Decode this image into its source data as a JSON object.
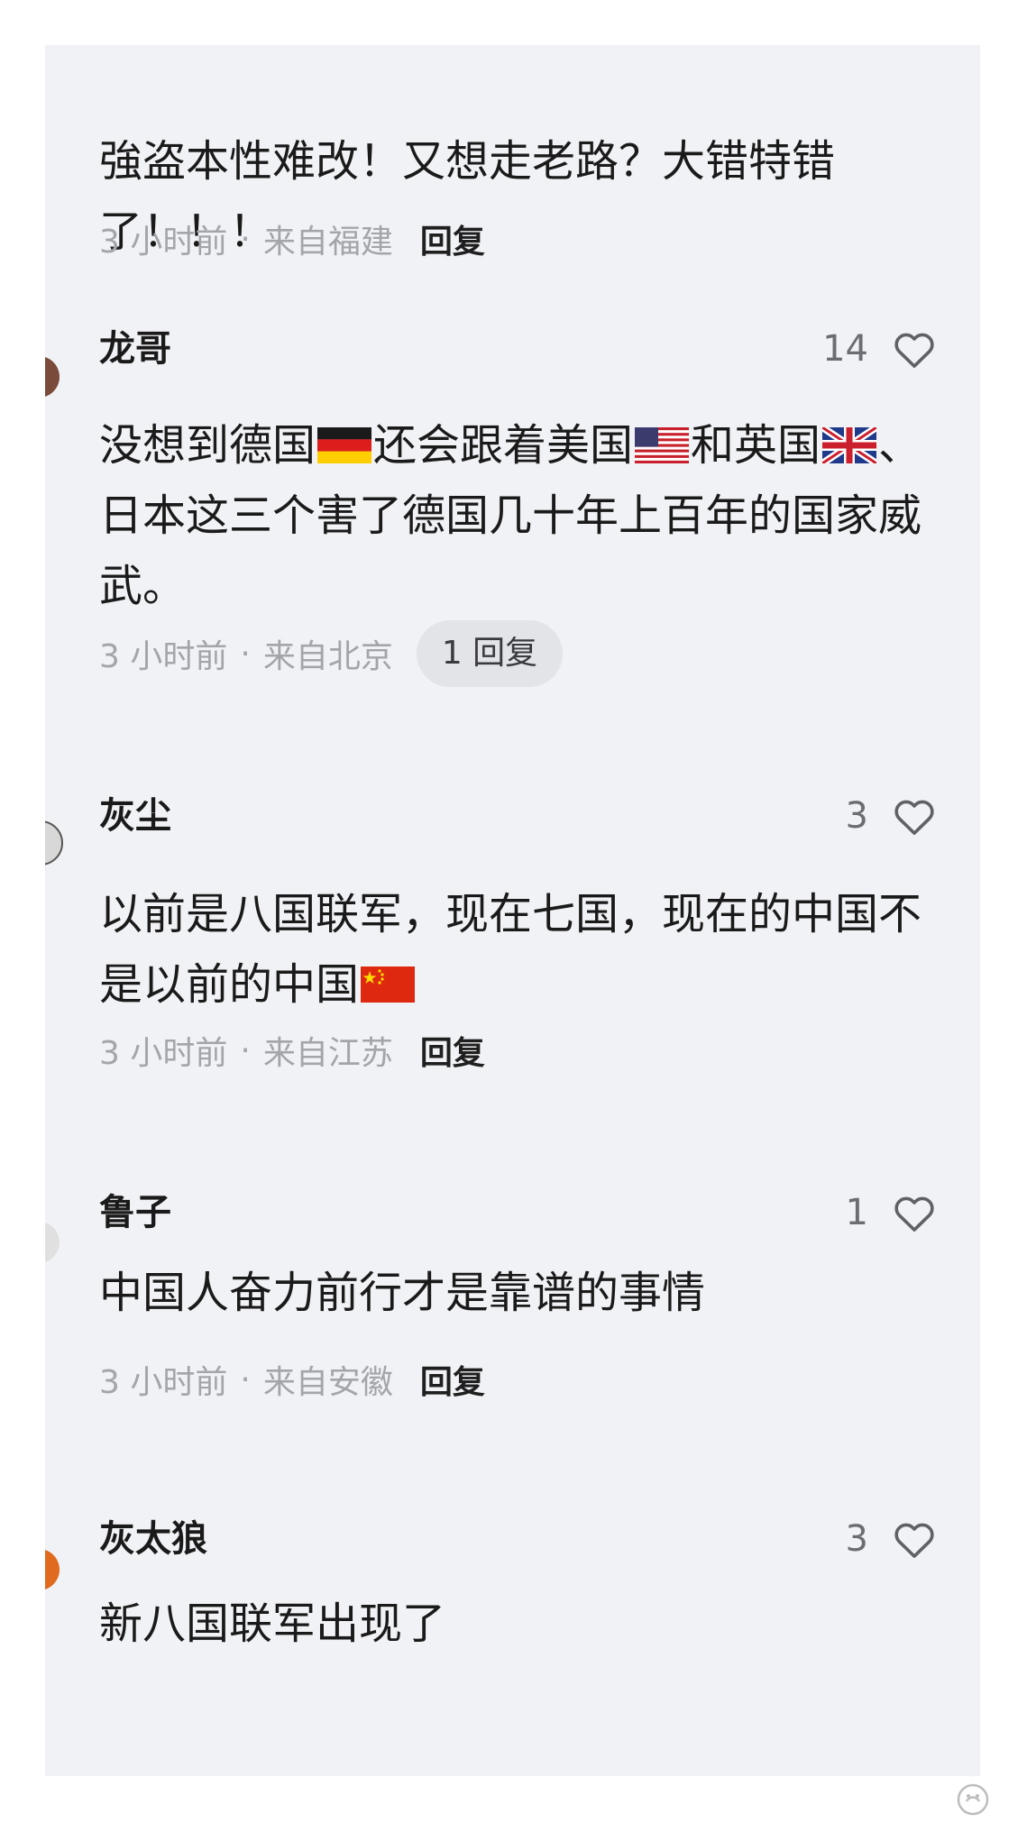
{
  "comments": [
    {
      "username": "",
      "text": "強盗本性难改！又想走老路？大错特错了！！！",
      "time": "3 小时前",
      "location": "来自福建",
      "reply": "回复"
    },
    {
      "username": "龙哥",
      "likes": "14",
      "text_parts": [
        "没想到德国",
        "还会跟着美国",
        "和英国",
        "、日本这三个害了德国几十年上百年的国家威武。"
      ],
      "flags": [
        "germany-flag-icon",
        "usa-flag-icon",
        "uk-flag-icon"
      ],
      "time": "3 小时前",
      "location": "来自北京",
      "reply": "1 回复"
    },
    {
      "username": "灰尘",
      "likes": "3",
      "text_parts": [
        "以前是八国联军，现在七国，现在的中国不是以前的中国"
      ],
      "flags": [
        "china-flag-icon"
      ],
      "time": "3 小时前",
      "location": "来自江苏",
      "reply": "回复"
    },
    {
      "username": "鲁子",
      "likes": "1",
      "text": "中国人奋力前行才是靠谱的事情",
      "time": "3 小时前",
      "location": "来自安徽",
      "reply": "回复"
    },
    {
      "username": "灰太狼",
      "likes": "3",
      "text": "新八国联军出现了"
    }
  ],
  "separator": "·",
  "icons": {
    "like": "heart-outline-icon",
    "watermark": "watermark-logo-icon"
  },
  "colors": {
    "panel_bg": "#f1f2f5",
    "text": "#1a1a1a",
    "meta": "#a3a5aa",
    "reply_pill_bg": "#e3e4e8"
  }
}
